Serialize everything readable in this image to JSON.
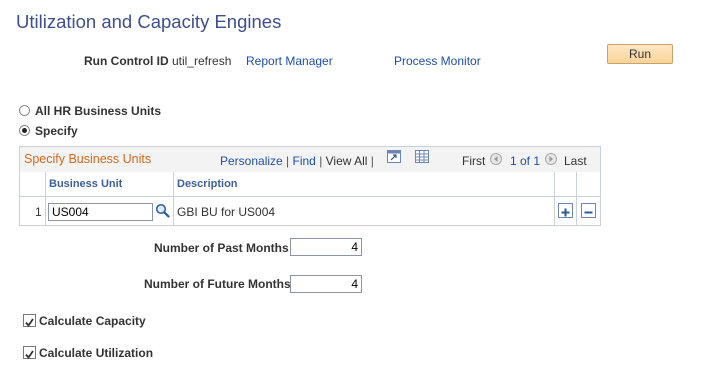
{
  "page": {
    "title": "Utilization and Capacity Engines"
  },
  "header": {
    "run_control_label": "Run Control ID",
    "run_control_value": "util_refresh",
    "report_manager_link": "Report Manager",
    "process_monitor_link": "Process Monitor",
    "run_button": "Run"
  },
  "options": {
    "all_units_label": "All HR Business Units",
    "specify_label": "Specify",
    "selected": "specify"
  },
  "grid": {
    "title": "Specify Business Units",
    "personalize": "Personalize",
    "find": "Find",
    "view_all": "View All",
    "first": "First",
    "page_info": "1 of 1",
    "last": "Last",
    "columns": {
      "business_unit": "Business Unit",
      "description": "Description"
    },
    "rows": [
      {
        "index": "1",
        "business_unit": "US004",
        "description": "GBI BU for US004"
      }
    ]
  },
  "fields": {
    "past_months_label": "Number of Past Months",
    "past_months_value": "4",
    "future_months_label": "Number of Future Months",
    "future_months_value": "4"
  },
  "checks": {
    "capacity_label": "Calculate Capacity",
    "capacity_checked": true,
    "utilization_label": "Calculate Utilization",
    "utilization_checked": true
  }
}
